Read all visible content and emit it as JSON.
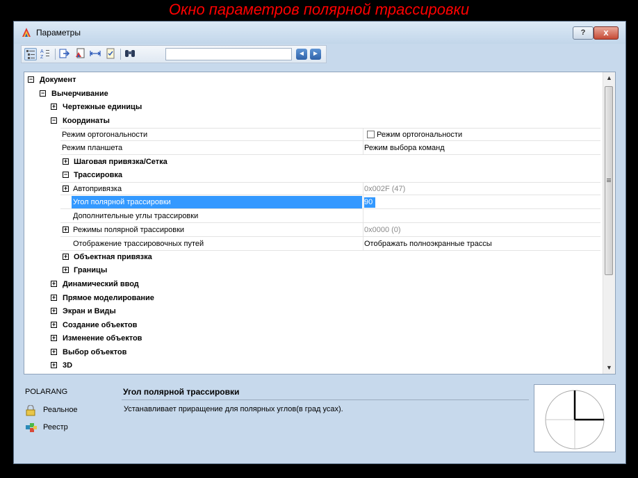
{
  "caption": "Окно параметров полярной трассировки",
  "window": {
    "title": "Параметры",
    "help_label": "?",
    "close_label": "x"
  },
  "toolbar": {
    "search_value": "",
    "back_label": "◄",
    "forward_label": "►"
  },
  "tree": {
    "document": "Документ",
    "drafting": "Вычерчивание",
    "drawing_units": "Чертежные единицы",
    "coordinates": "Координаты",
    "ortho_mode_label": "Режим ортогональности",
    "ortho_mode_value": "Режим ортогональности",
    "tablet_mode_label": "Режим планшета",
    "tablet_mode_value": "Режим выбора команд",
    "snap_grid": "Шаговая привязка/Сетка",
    "tracking": "Трассировка",
    "autosnap_label": "Автопривязка",
    "autosnap_value": "0x002F (47)",
    "polar_angle_label": "Угол полярной трассировки",
    "polar_angle_value": "90",
    "additional_angles_label": "Дополнительные углы трассировки",
    "additional_angles_value": "",
    "polar_modes_label": "Режимы полярной трассировки",
    "polar_modes_value": "0x0000 (0)",
    "tracking_paths_label": "Отображение трассировочных путей",
    "tracking_paths_value": "Отображать полноэкранные трассы",
    "object_snap": "Объектная привязка",
    "limits": "Границы",
    "dynamic_input": "Динамический ввод",
    "direct_modeling": "Прямое моделирование",
    "screen_views": "Экран и Виды",
    "object_creation": "Создание объектов",
    "object_modification": "Изменение объектов",
    "object_selection": "Выбор объектов",
    "three_d": "3D"
  },
  "bottom": {
    "sysvar": "POLARANG",
    "type_label": "Реальное",
    "storage_label": "Реестр",
    "desc_title": "Угол полярной трассировки",
    "desc_text": "Устанавливает приращение для полярных углов(в град усах)."
  },
  "colors": {
    "caption": "#ff0000",
    "selection": "#3399ff",
    "window_bg": "#c7d9ec"
  }
}
